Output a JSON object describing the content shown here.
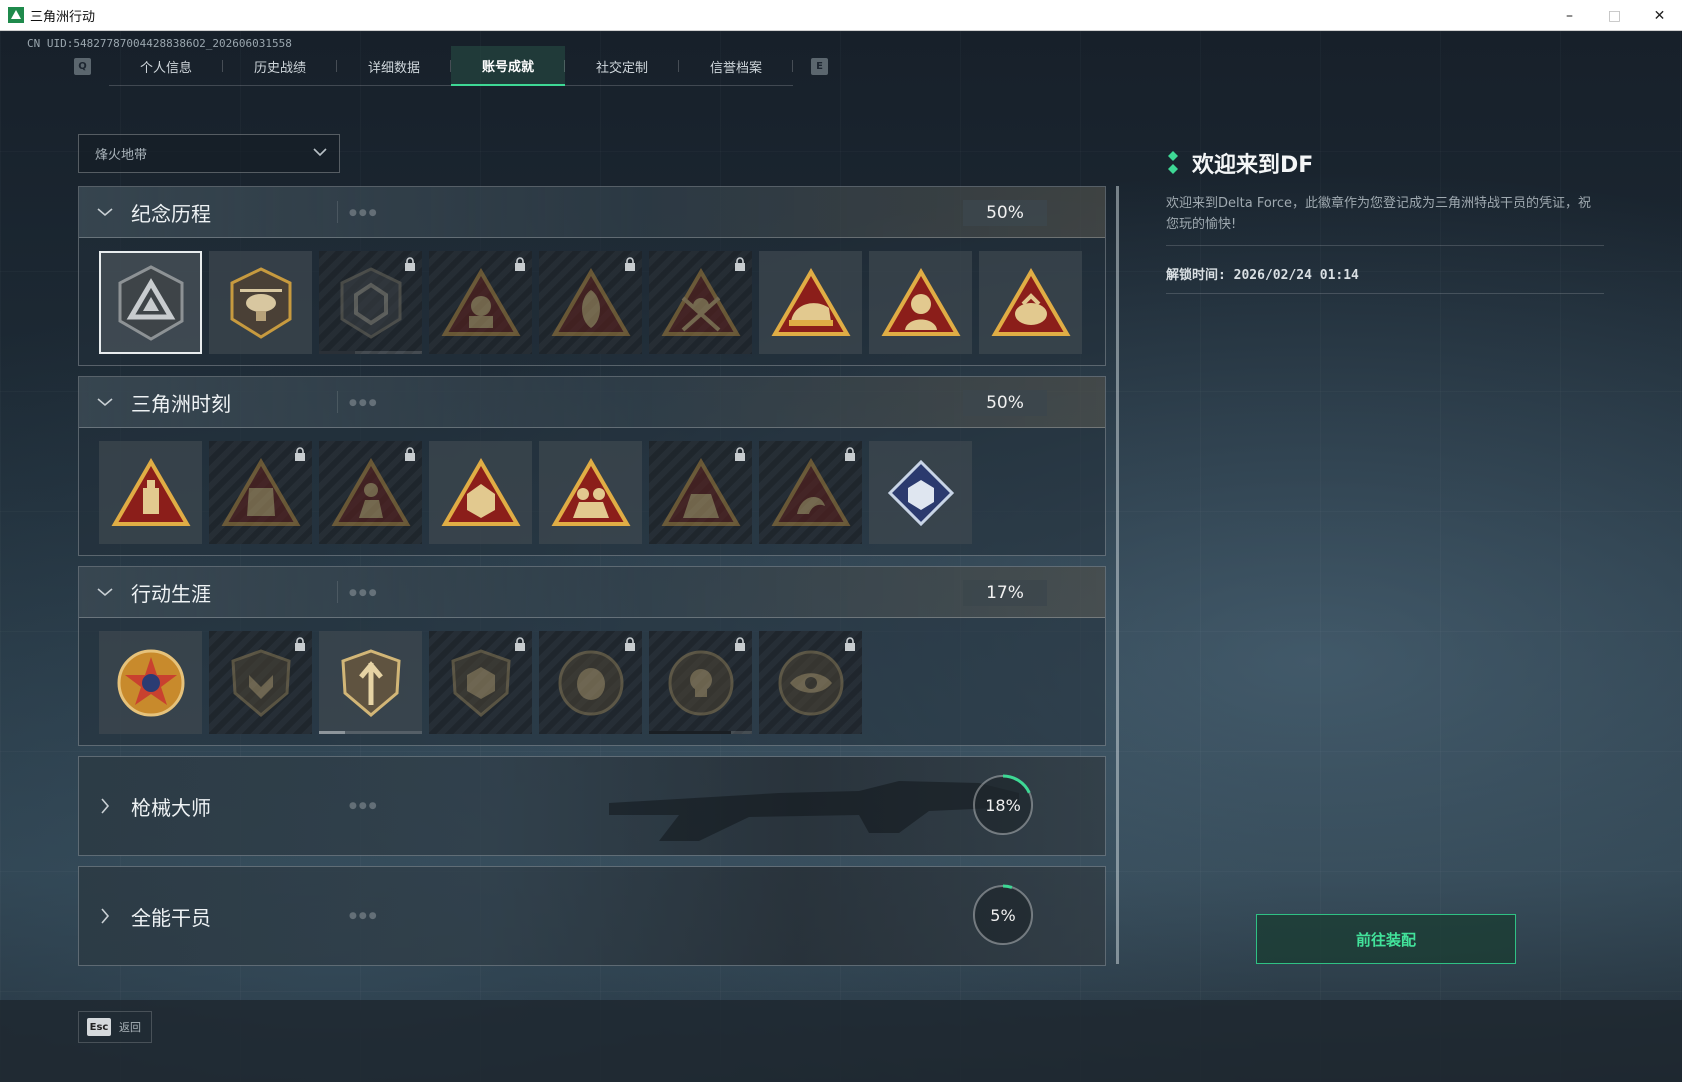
{
  "window": {
    "title": "三角洲行动",
    "controls": [
      "minimize",
      "maximize",
      "close"
    ]
  },
  "uid": "CN UID:548277870044288386O2_202606031558",
  "tabs": {
    "left_key": "Q",
    "right_key": "E",
    "items": [
      {
        "label": "个人信息"
      },
      {
        "label": "历史战绩"
      },
      {
        "label": "详细数据"
      },
      {
        "label": "账号成就",
        "active": true
      },
      {
        "label": "社交定制"
      },
      {
        "label": "信誉档案"
      }
    ]
  },
  "filter": {
    "selected": "烽火地带"
  },
  "sections": [
    {
      "name": "纪念历程",
      "percent": "50%",
      "expanded": true,
      "badges": [
        {
          "icon": "triangle-emblem-icon",
          "locked": false,
          "selected": true
        },
        {
          "icon": "helicopter-badge-icon",
          "locked": false
        },
        {
          "icon": "shield-emblem-icon",
          "locked": true
        },
        {
          "icon": "operator-triangle-icon",
          "locked": true
        },
        {
          "icon": "hooded-figure-icon",
          "locked": true
        },
        {
          "icon": "crossed-swords-icon",
          "locked": true
        },
        {
          "icon": "helmet-triangle-icon",
          "locked": false
        },
        {
          "icon": "soldier-triangle-icon",
          "locked": false
        },
        {
          "icon": "bag-triangle-icon",
          "locked": false
        }
      ]
    },
    {
      "name": "三角洲时刻",
      "percent": "50%",
      "expanded": true,
      "badges": [
        {
          "icon": "bottle-triangle-icon",
          "locked": false
        },
        {
          "icon": "vest-triangle-icon",
          "locked": true
        },
        {
          "icon": "kneeling-figure-icon",
          "locked": true
        },
        {
          "icon": "dice-triangle-icon",
          "locked": false
        },
        {
          "icon": "squad-triangle-icon",
          "locked": false
        },
        {
          "icon": "team-triangle-icon",
          "locked": true
        },
        {
          "icon": "dragon-triangle-icon",
          "locked": true
        },
        {
          "icon": "blue-diamond-book-icon",
          "locked": false
        }
      ]
    },
    {
      "name": "行动生涯",
      "percent": "17%",
      "expanded": true,
      "badges": [
        {
          "icon": "star-medal-icon",
          "locked": false
        },
        {
          "icon": "wing-shield-icon",
          "locked": true
        },
        {
          "icon": "arrow-shield-icon",
          "locked": false
        },
        {
          "icon": "hex-shield-icon",
          "locked": true
        },
        {
          "icon": "round-orb-icon",
          "locked": true
        },
        {
          "icon": "skull-round-icon",
          "locked": true
        },
        {
          "icon": "eye-round-icon",
          "locked": true
        }
      ]
    },
    {
      "name": "枪械大师",
      "percent": "18%",
      "progress": 0.18,
      "expanded": false
    },
    {
      "name": "全能干员",
      "percent": "5%",
      "progress": 0.05,
      "expanded": false
    }
  ],
  "detail": {
    "title": "欢迎来到DF",
    "description": "欢迎来到Delta Force，此徽章作为您登记成为三角洲特战干员的凭证，祝您玩的愉快!",
    "unlock": "解锁时间: 2026/02/24 01:14"
  },
  "equip_button": "前往装配",
  "footer": {
    "esc_key": "Esc",
    "esc_label": "返回"
  },
  "colors": {
    "accent": "#3ed895",
    "badge_gold": "#d4a23a",
    "badge_red": "#8b1e1a"
  }
}
